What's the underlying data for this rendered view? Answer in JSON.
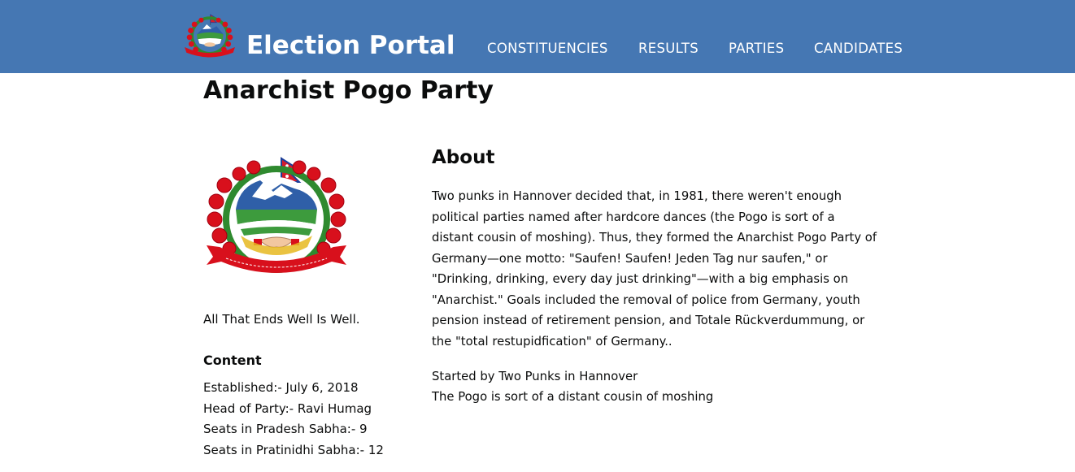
{
  "header": {
    "brand": "Election Portal",
    "nav": [
      {
        "label": "CONSTITUENCIES"
      },
      {
        "label": "RESULTS"
      },
      {
        "label": "PARTIES"
      },
      {
        "label": "CANDIDATES"
      }
    ],
    "background_color": "#4577b3"
  },
  "party": {
    "name": "Anarchist Pogo Party",
    "motto": "All That Ends Well Is Well.",
    "emblem_icon": "nepal-emblem-icon",
    "content_heading": "Content",
    "facts": [
      "Established:- July 6, 2018",
      "Head of Party:- Ravi Humag",
      "Seats in Pradesh Sabha:- 9",
      "Seats in Pratinidhi Sabha:- 12"
    ]
  },
  "about": {
    "heading": "About",
    "body": "Two punks in Hannover decided that, in 1981, there weren't enough political parties named after hardcore dances (the Pogo is sort of a distant cousin of moshing). Thus, they formed the Anarchist Pogo Party of Germany—one motto: \"Saufen! Saufen! Jeden Tag nur saufen,\" or \"Drinking, drinking, every day just drinking\"—with a big emphasis on \"Anarchist.\" Goals included the removal of police from Germany, youth pension instead of retirement pension, and Totale Rückverdummung, or the \"total restupidfication\" of Germany..",
    "lines": [
      "Started by Two Punks in Hannover",
      "The Pogo is sort of a distant cousin of moshing"
    ]
  }
}
